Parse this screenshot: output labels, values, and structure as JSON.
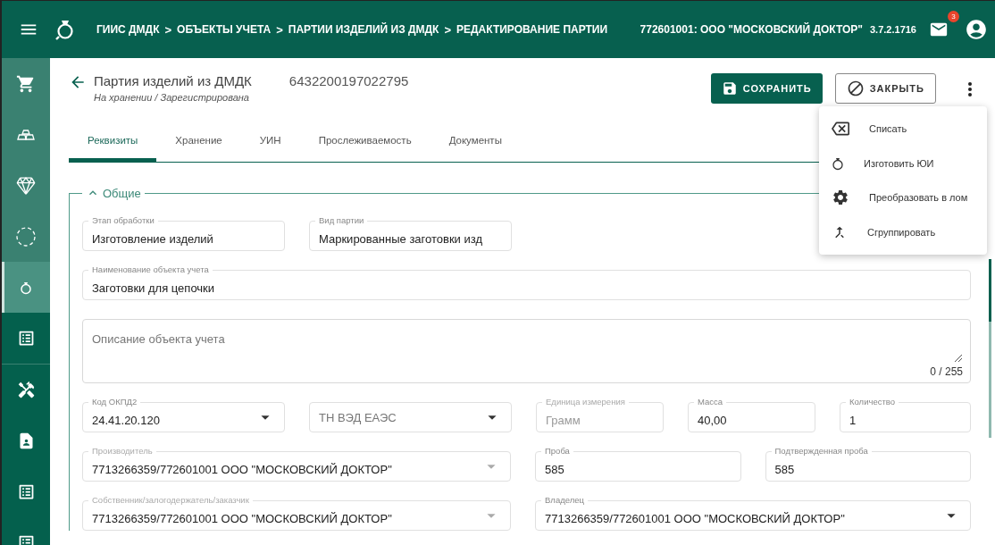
{
  "topbar": {
    "breadcrumbs": [
      "ГИИС ДМДК",
      "ОБЪЕКТЫ УЧЕТА",
      "ПАРТИИ ИЗДЕЛИЙ ИЗ ДМДК",
      "РЕДАКТИРОВАНИЕ ПАРТИИ"
    ],
    "separator": ">",
    "organization": "772601001: ООО \"МОСКОВСКИЙ ДОКТОР\"",
    "version": "3.7.2.1716",
    "notification_count": "3"
  },
  "sidebar": {
    "groups": [
      {
        "items": [
          {
            "selected": false
          },
          {
            "selected": false
          },
          {
            "selected": false
          },
          {
            "selected": false
          },
          {
            "selected": true
          },
          {
            "selected": false
          }
        ]
      },
      {
        "items": [
          {
            "selected": false
          },
          {
            "selected": false
          },
          {
            "selected": false
          },
          {
            "selected": false
          }
        ]
      }
    ]
  },
  "header": {
    "title": "Партия изделий из ДМДК",
    "number": "6432200197022795",
    "status": "На хранении / Зарегистрирована"
  },
  "actions": [
    {
      "label": "СОХРАНИТЬ",
      "kind": "primary"
    },
    {
      "label": "ЗАКРЫТЬ",
      "kind": "outlined"
    }
  ],
  "menu": [
    {
      "label": "Списать"
    },
    {
      "label": "Изготовить ЮИ"
    },
    {
      "label": "Преобразовать в лом"
    },
    {
      "label": "Сгруппировать"
    }
  ],
  "tabs": [
    {
      "label": "Реквизиты",
      "selected": true
    },
    {
      "label": "Хранение",
      "selected": false
    },
    {
      "label": "УИН",
      "selected": false
    },
    {
      "label": "Прослеживаемость",
      "selected": false
    },
    {
      "label": "Документы",
      "selected": false
    }
  ],
  "section": {
    "title": "Общие",
    "expanded": true,
    "fields": [
      {
        "kind": "text",
        "label": "Этап обработки",
        "value": "Изготовление изделий",
        "disabled": false
      },
      {
        "kind": "text",
        "label": "Вид партии",
        "value": "Маркированные заготовки изд",
        "disabled": false
      },
      {
        "kind": "text",
        "label": "Наименование объекта учета",
        "value": "Заготовки для цепочки",
        "disabled": false
      },
      {
        "kind": "textarea",
        "placeholder": "Описание объекта учета",
        "counter": "0 / 255",
        "disabled": false
      },
      {
        "kind": "select",
        "label": "Код ОКПД2",
        "value": "24.41.20.120",
        "disabled": false
      },
      {
        "kind": "select",
        "placeholder": "ТН ВЭД ЕАЭС",
        "disabled": false
      },
      {
        "kind": "text",
        "label": "Единица измерения",
        "value": "Грамм",
        "disabled": true
      },
      {
        "kind": "text",
        "label": "Масса",
        "value": "40,00",
        "disabled": false
      },
      {
        "kind": "text",
        "label": "Количество",
        "value": "1",
        "disabled": false
      },
      {
        "kind": "select",
        "label": "Производитель",
        "value": "7713266359/772601001 ООО \"МОСКОВСКИЙ ДОКТОР\"",
        "disabled": true
      },
      {
        "kind": "text",
        "label": "Проба",
        "value": "585",
        "disabled": false
      },
      {
        "kind": "text",
        "label": "Подтвержденная проба",
        "value": "585",
        "disabled": false
      },
      {
        "kind": "select",
        "label": "Собственник/залогодержатель/заказчик",
        "value": "7713266359/772601001 ООО \"МОСКОВСКИЙ ДОКТОР\"",
        "disabled": true
      },
      {
        "kind": "select",
        "label": "Владелец",
        "value": "7713266359/772601001 ООО \"МОСКОВСКИЙ ДОКТОР\"",
        "disabled": false
      }
    ]
  }
}
